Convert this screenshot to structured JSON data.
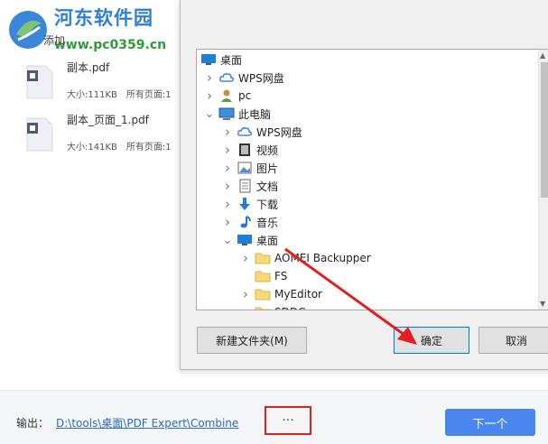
{
  "watermark": {
    "title": "河东软件园",
    "url": "www.pc0359.cn"
  },
  "toolbar": {
    "add_label": "添加"
  },
  "files": [
    {
      "name": "副本.pdf",
      "size": "大小:111KB",
      "pages": "所有页面:1"
    },
    {
      "name": "副本_页面_1.pdf",
      "size": "大小:141KB",
      "pages": "所有页面:1"
    }
  ],
  "output": {
    "label": "输出：",
    "path": "D:\\tools\\桌面\\PDF Expert\\Combine",
    "more_label": "···",
    "next_label": "下一个"
  },
  "dialog": {
    "tree": [
      {
        "label": "桌面",
        "icon": "desktop-icon",
        "level": 0,
        "chevron": ""
      },
      {
        "label": "WPS网盘",
        "icon": "cloud-icon",
        "level": 1,
        "chevron": "right"
      },
      {
        "label": "pc",
        "icon": "user-icon",
        "level": 1,
        "chevron": "right"
      },
      {
        "label": "此电脑",
        "icon": "computer-icon",
        "level": 1,
        "chevron": "down"
      },
      {
        "label": "WPS网盘",
        "icon": "cloud-icon",
        "level": 2,
        "chevron": "right"
      },
      {
        "label": "视频",
        "icon": "video-icon",
        "level": 2,
        "chevron": "right"
      },
      {
        "label": "图片",
        "icon": "picture-icon",
        "level": 2,
        "chevron": "right"
      },
      {
        "label": "文档",
        "icon": "document-icon",
        "level": 2,
        "chevron": "right"
      },
      {
        "label": "下载",
        "icon": "download-icon",
        "level": 2,
        "chevron": "right"
      },
      {
        "label": "音乐",
        "icon": "music-icon",
        "level": 2,
        "chevron": "right"
      },
      {
        "label": "桌面",
        "icon": "desktop-icon",
        "level": 2,
        "chevron": "down"
      },
      {
        "label": "AOMEI Backupper",
        "icon": "folder-icon",
        "level": 3,
        "chevron": "right"
      },
      {
        "label": "FS",
        "icon": "folder-icon",
        "level": 3,
        "chevron": ""
      },
      {
        "label": "MyEditor",
        "icon": "folder-icon",
        "level": 3,
        "chevron": "right"
      },
      {
        "label": "SDDC",
        "icon": "folder-icon",
        "level": 3,
        "chevron": "right"
      }
    ],
    "new_folder_label": "新建文件夹(M)",
    "ok_label": "确定",
    "cancel_label": "取消"
  },
  "colors": {
    "accent": "#4a86f0",
    "link": "#2b6cc4",
    "highlight": "#e02020"
  }
}
